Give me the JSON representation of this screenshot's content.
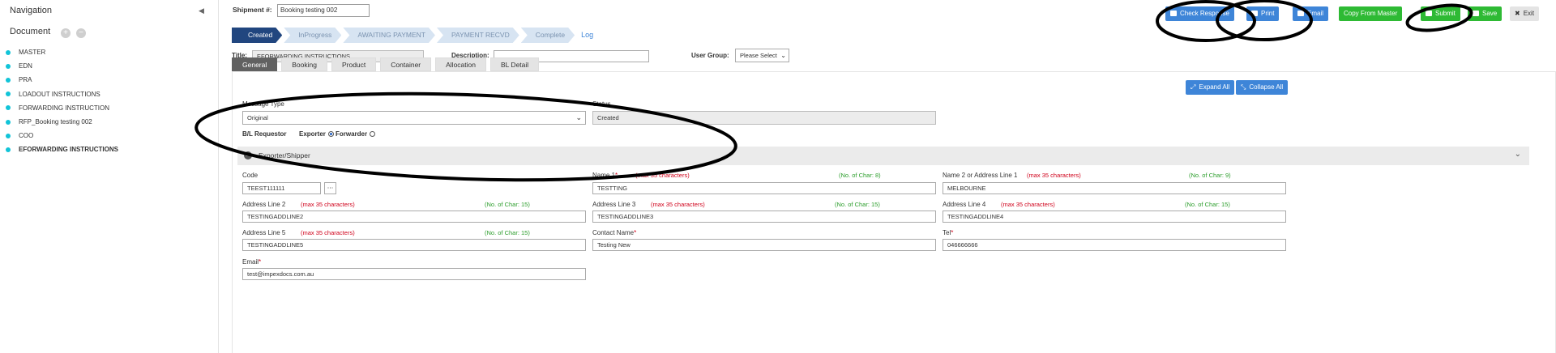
{
  "sidebar": {
    "title": "Navigation",
    "document_label": "Document",
    "items": [
      {
        "label": "MASTER"
      },
      {
        "label": "EDN"
      },
      {
        "label": "PRA"
      },
      {
        "label": "LOADOUT INSTRUCTIONS"
      },
      {
        "label": "FORWARDING INSTRUCTION"
      },
      {
        "label": "RFP_Booking testing 002"
      },
      {
        "label": "COO"
      },
      {
        "label": "EFORWARDING INSTRUCTIONS",
        "active": true
      }
    ]
  },
  "header": {
    "shipment_label": "Shipment #:",
    "shipment_value": "Booking testing 002"
  },
  "toolbar": {
    "check_response": "Check Response",
    "print": "Print",
    "email": "Email",
    "copy_from_master": "Copy From Master",
    "submit": "Submit",
    "save": "Save",
    "exit": "Exit"
  },
  "steps": [
    "Created",
    "InProgress",
    "AWAITING PAYMENT",
    "PAYMENT RECVD",
    "Complete"
  ],
  "steps_active": "Created",
  "log_label": "Log",
  "form_top": {
    "title_label": "Title:",
    "title_value": "EFORWARDING INSTRUCTIONS",
    "description_label": "Description:",
    "description_value": "",
    "user_group_label": "User Group:",
    "user_group_value": "Please Select"
  },
  "tabs": [
    "General",
    "Booking",
    "Product",
    "Container",
    "Allocation",
    "BL Detail"
  ],
  "active_tab": "General",
  "panel": {
    "expand_all": "Expand All",
    "collapse_all": "Collapse All",
    "message_type_label": "Message Type",
    "message_type_value": "Original",
    "status_label": "Status",
    "status_value": "Created",
    "bl_requestor_label": "B/L Requestor",
    "exporter_label": "Exporter",
    "forwarder_label": "Forwarder",
    "selected_requestor": "Exporter"
  },
  "section": {
    "title": "Exporter/Shipper",
    "max_note": "(max 35 characters)",
    "code_label": "Code",
    "code_value": "TEEST111111",
    "name1_label": "Name 1",
    "name1_count": "(No. of Char: 8)",
    "name1_value": "TESTTING",
    "name2_label": "Name 2 or Address Line 1",
    "name2_count": "(No. of Char: 9)",
    "name2_value": "MELBOURNE",
    "addr2_label": "Address Line 2",
    "addr2_count": "(No. of Char: 15)",
    "addr2_value": "TESTINGADDLINE2",
    "addr3_label": "Address Line 3",
    "addr3_count": "(No. of Char: 15)",
    "addr3_value": "TESTINGADDLINE3",
    "addr4_label": "Address Line 4",
    "addr4_count": "(No. of Char: 15)",
    "addr4_value": "TESTINGADDLINE4",
    "addr5_label": "Address Line 5",
    "addr5_count": "(No. of Char: 15)",
    "addr5_value": "TESTINGADDLINE5",
    "contact_label": "Contact Name",
    "contact_value": "Testing New",
    "tel_label": "Tel",
    "tel_value": "046666666",
    "email_label": "Email",
    "email_value": "test@impexdocs.com.au"
  },
  "colors": {
    "primary": "#3e85d8",
    "success": "#2eba34",
    "step_active": "#21467f",
    "step_inactive": "#d7e4f2",
    "tree_dot": "#11c4d8",
    "required": "#d0021b"
  }
}
